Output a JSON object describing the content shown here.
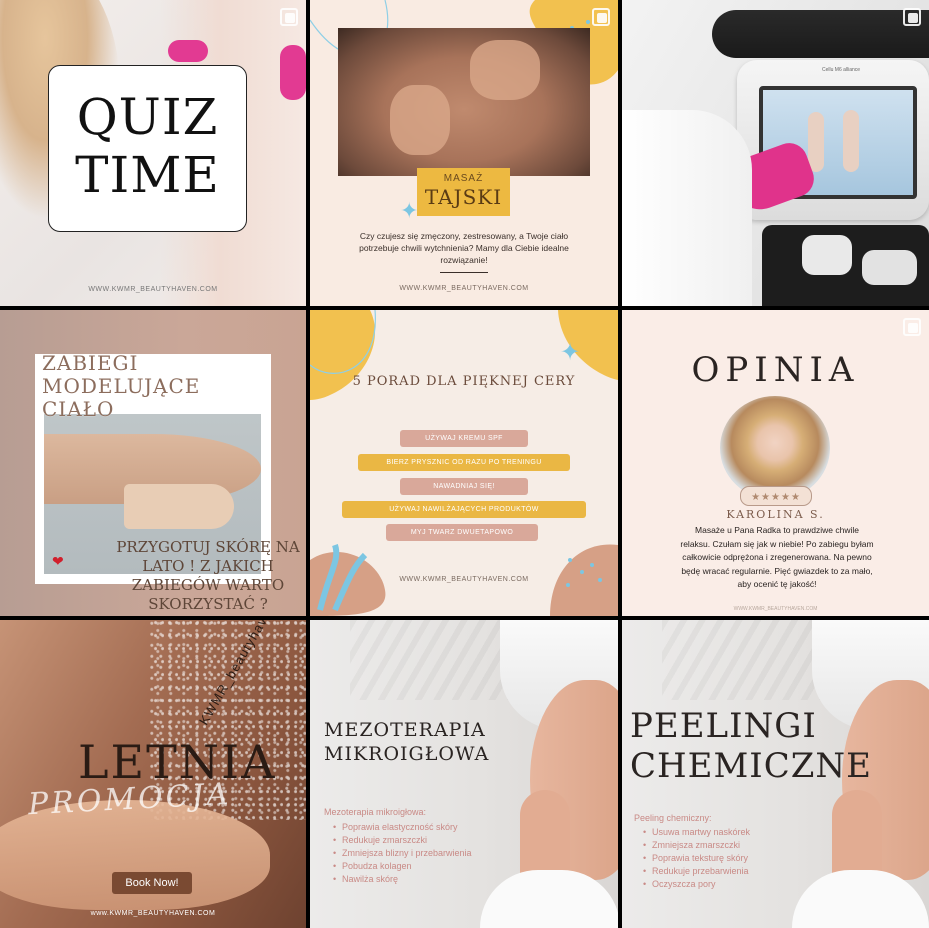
{
  "tiles": {
    "quiz": {
      "line1": "QUIZ",
      "line2": "TIME",
      "website": "WWW.KWMR_BEAUTYHAVEN.COM"
    },
    "masaz": {
      "small": "MASAŻ",
      "big": "TAJSKI",
      "text": "Czy czujesz się zmęczony, zestresowany, a Twoje ciało potrzebuje chwili wytchnienia? Mamy dla Ciebie idealne rozwiązanie!",
      "website": "WWW.KWMR_BEAUTYHAVEN.COM",
      "device_label": "Cellu M6 alliance"
    },
    "zabiegi": {
      "title": "ZABIEGI MODELUJĄCE CIAŁO",
      "subtitle": "PRZYGOTUJ SKÓRĘ NA LATO ! Z JAKICH ZABIEGÓW WARTO SKORZYSTAĆ ?"
    },
    "porady": {
      "title": "5 PORAD DLA PIĘKNEJ CERY",
      "items": [
        "UŻYWAJ KREMU SPF",
        "BIERZ PRYSZNIC OD RAZU PO TRENINGU",
        "NAWADNIAJ SIĘ!",
        "UŻYWAJ NAWILŻAJĄCYCH PRODUKTÓW",
        "MYJ TWARZ DWUETAPOWO"
      ],
      "website": "WWW.KWMR_BEAUTYHAVEN.COM"
    },
    "opinia": {
      "title": "OPINIA",
      "stars": "★★★★★",
      "name": "KAROLINA S.",
      "text": "Masaże u Pana Radka to prawdziwe chwile relaksu. Czułam się jak w niebie! Po zabiegu byłam całkowicie odprężona i zregenerowana. Na pewno będę wracać regularnie. Pięć gwiazdek to za mało, aby ocenić tę jakość!",
      "website": "WWW.KWMR_BEAUTYHAVEN.COM"
    },
    "letnia": {
      "title": "LETNIA",
      "script": "PROMOCJA",
      "brand": "KWMR_beautyhaven",
      "button": "Book Now!",
      "website": "www.KWMR_BEAUTYHAVEN.COM"
    },
    "mezo": {
      "title_1": "MEZOTERAPIA",
      "title_2": "MIKROIGŁOWA",
      "lead": "Mezoterapia mikroigłowa:",
      "items": [
        "Poprawia elastyczność skóry",
        "Redukuje zmarszczki",
        "Zmniejsza blizny i przebarwienia",
        "Pobudza kolagen",
        "Nawilża skórę"
      ]
    },
    "peel": {
      "title_1": "PEELINGI",
      "title_2": "CHEMICZNE",
      "lead": "Peeling chemiczny:",
      "items": [
        "Usuwa martwy naskórek",
        "Zmniejsza zmarszczki",
        "Poprawia teksturę skóry",
        "Redukuje przebarwienia",
        "Oczyszcza pory"
      ]
    }
  },
  "colors": {
    "gold": "#e9b93a",
    "rose": "#d1a092",
    "cream": "#f7ece4",
    "pink": "#e0338b",
    "blue": "#8fcfe6"
  }
}
